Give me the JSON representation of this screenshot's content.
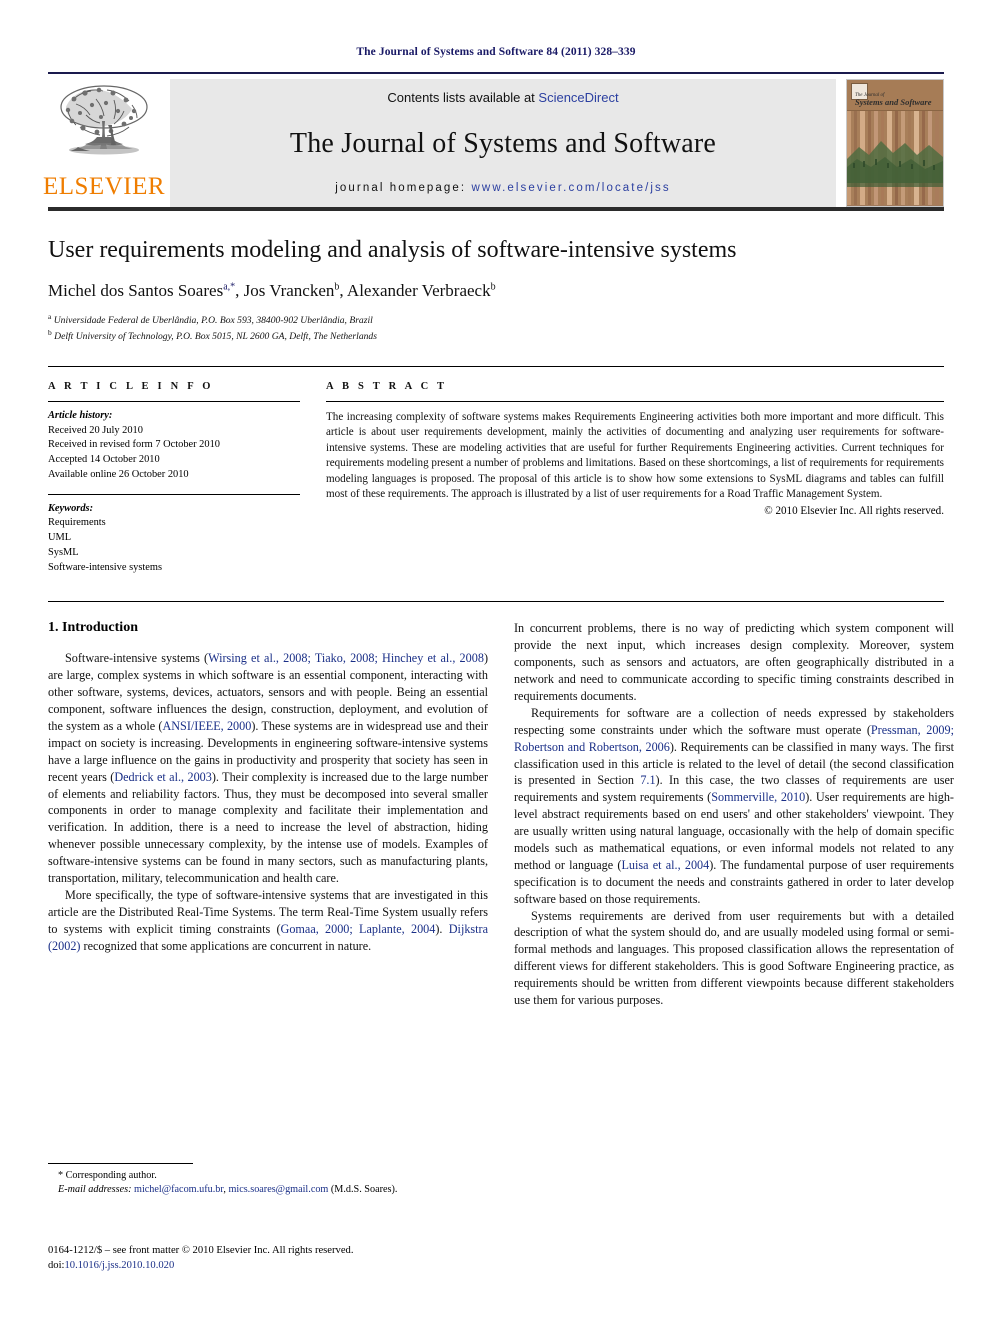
{
  "running_head": "The Journal of Systems and Software 84 (2011) 328–339",
  "masthead": {
    "publisher_name": "ELSEVIER",
    "contents_prefix": "Contents lists available at ",
    "contents_link": "ScienceDirect",
    "journal_title": "The Journal of Systems and Software",
    "homepage_prefix": "journal homepage: ",
    "homepage_url": "www.elsevier.com/locate/jss",
    "cover_title_small": "The Journal of",
    "cover_title": "Systems and Software"
  },
  "article": {
    "title": "User requirements modeling and analysis of software-intensive systems",
    "authors": "Michel dos Santos Soares",
    "author_marks_1": "a,*",
    "author_2": ", Jos Vrancken",
    "author_marks_2": "b",
    "author_3": ", Alexander Verbraeck",
    "author_marks_3": "b",
    "affiliation_a_mark": "a",
    "affiliation_a": "Universidade Federal de Uberlândia, P.O. Box 593, 38400-902 Uberlândia, Brazil",
    "affiliation_b_mark": "b",
    "affiliation_b": "Delft University of Technology, P.O. Box 5015, NL 2600 GA, Delft, The Netherlands"
  },
  "article_info": {
    "heading": "A R T I C L E  I N F O",
    "history_label": "Article history:",
    "history": [
      "Received 20 July 2010",
      "Received in revised form 7 October 2010",
      "Accepted 14 October 2010",
      "Available online 26 October 2010"
    ],
    "keywords_label": "Keywords:",
    "keywords": [
      "Requirements",
      "UML",
      "SysML",
      "Software-intensive systems"
    ]
  },
  "abstract": {
    "heading": "A B S T R A C T",
    "text": "The increasing complexity of software systems makes Requirements Engineering activities both more important and more difficult. This article is about user requirements development, mainly the activities of documenting and analyzing user requirements for software-intensive systems. These are modeling activities that are useful for further Requirements Engineering activities. Current techniques for requirements modeling present a number of problems and limitations. Based on these shortcomings, a list of requirements for requirements modeling languages is proposed. The proposal of this article is to show how some extensions to SysML diagrams and tables can fulfill most of these requirements. The approach is illustrated by a list of user requirements for a Road Traffic Management System.",
    "copyright": "© 2010 Elsevier Inc. All rights reserved."
  },
  "body": {
    "section_title": "1.  Introduction",
    "left_paragraphs": [
      {
        "runs": [
          {
            "t": "Software-intensive systems (",
            "cite": false
          },
          {
            "t": "Wirsing et al., 2008; Tiako, 2008; Hinchey et al., 2008",
            "cite": true
          },
          {
            "t": ") are large, complex systems in which software is an essential component, interacting with other software, systems, devices, actuators, sensors and with people. Being an essential component, software influences the design, construction, deployment, and evolution of the system as a whole (",
            "cite": false
          },
          {
            "t": "ANSI/IEEE, 2000",
            "cite": true
          },
          {
            "t": "). These systems are in widespread use and their impact on society is increasing. Developments in engineering software-intensive systems have a large influence on the gains in productivity and prosperity that society has seen in recent years (",
            "cite": false
          },
          {
            "t": "Dedrick et al., 2003",
            "cite": true
          },
          {
            "t": "). Their complexity is increased due to the large number of elements and reliability factors. Thus, they must be decomposed into several smaller components in order to manage complexity and facilitate their implementation and verification. In addition, there is a need to increase the level of abstraction, hiding whenever possible unnecessary complexity, by the intense use of models. Examples of software-intensive systems can be found in many sectors, such as manufacturing plants, transportation, military, telecommunication and health care.",
            "cite": false
          }
        ]
      },
      {
        "runs": [
          {
            "t": "More specifically, the type of software-intensive systems that are investigated in this article are the Distributed Real-Time Systems. The term Real-Time System usually refers to systems with explicit timing constraints (",
            "cite": false
          },
          {
            "t": "Gomaa, 2000; Laplante, 2004",
            "cite": true
          },
          {
            "t": "). ",
            "cite": false
          },
          {
            "t": "Dijkstra (2002)",
            "cite": true
          },
          {
            "t": " recognized that some applications are concurrent in nature.",
            "cite": false
          }
        ]
      }
    ],
    "right_paragraphs": [
      {
        "indent": false,
        "runs": [
          {
            "t": "In concurrent problems, there is no way of predicting which system component will provide the next input, which increases design complexity. Moreover, system components, such as sensors and actuators, are often geographically distributed in a network and need to communicate according to specific timing constraints described in requirements documents.",
            "cite": false
          }
        ]
      },
      {
        "indent": true,
        "runs": [
          {
            "t": "Requirements for software are a collection of needs expressed by stakeholders respecting some constraints under which the software must operate (",
            "cite": false
          },
          {
            "t": "Pressman, 2009; Robertson and Robertson, 2006",
            "cite": true
          },
          {
            "t": "). Requirements can be classified in many ways. The first classification used in this article is related to the level of detail (the second classification is presented in Section ",
            "cite": false
          },
          {
            "t": "7.1",
            "cite": true
          },
          {
            "t": "). In this case, the two classes of requirements are user requirements and system requirements (",
            "cite": false
          },
          {
            "t": "Sommerville, 2010",
            "cite": true
          },
          {
            "t": "). User requirements are high-level abstract requirements based on end users' and other stakeholders' viewpoint. They are usually written using natural language, occasionally with the help of domain specific models such as mathematical equations, or even informal models not related to any method or language (",
            "cite": false
          },
          {
            "t": "Luisa et al., 2004",
            "cite": true
          },
          {
            "t": "). The fundamental purpose of user requirements specification is to document the needs and constraints gathered in order to later develop software based on those requirements.",
            "cite": false
          }
        ]
      },
      {
        "indent": true,
        "runs": [
          {
            "t": "Systems requirements are derived from user requirements but with a detailed description of what the system should do, and are usually modeled using formal or semi-formal methods and languages. This proposed classification allows the representation of different views for different stakeholders. This is good Software Engineering practice, as requirements should be written from different viewpoints because different stakeholders use them for various purposes.",
            "cite": false
          }
        ]
      }
    ]
  },
  "footnote": {
    "corresponding": "* Corresponding author.",
    "email_label": "E-mail addresses:",
    "email_1": "michel@facom.ufu.br",
    "email_sep": ", ",
    "email_2": "mics.soares@gmail.com",
    "email_suffix": " (M.d.S. Soares)."
  },
  "imprint": {
    "line1": "0164-1212/$ – see front matter © 2010 Elsevier Inc. All rights reserved.",
    "doi_label": "doi:",
    "doi_value": "10.1016/j.jss.2010.10.020"
  },
  "colors": {
    "link_blue": "#2b3fa0",
    "cite_blue": "#1a2f87",
    "elsevier_orange": "#ef7d00",
    "running_head_navy": "#1a1a66"
  }
}
